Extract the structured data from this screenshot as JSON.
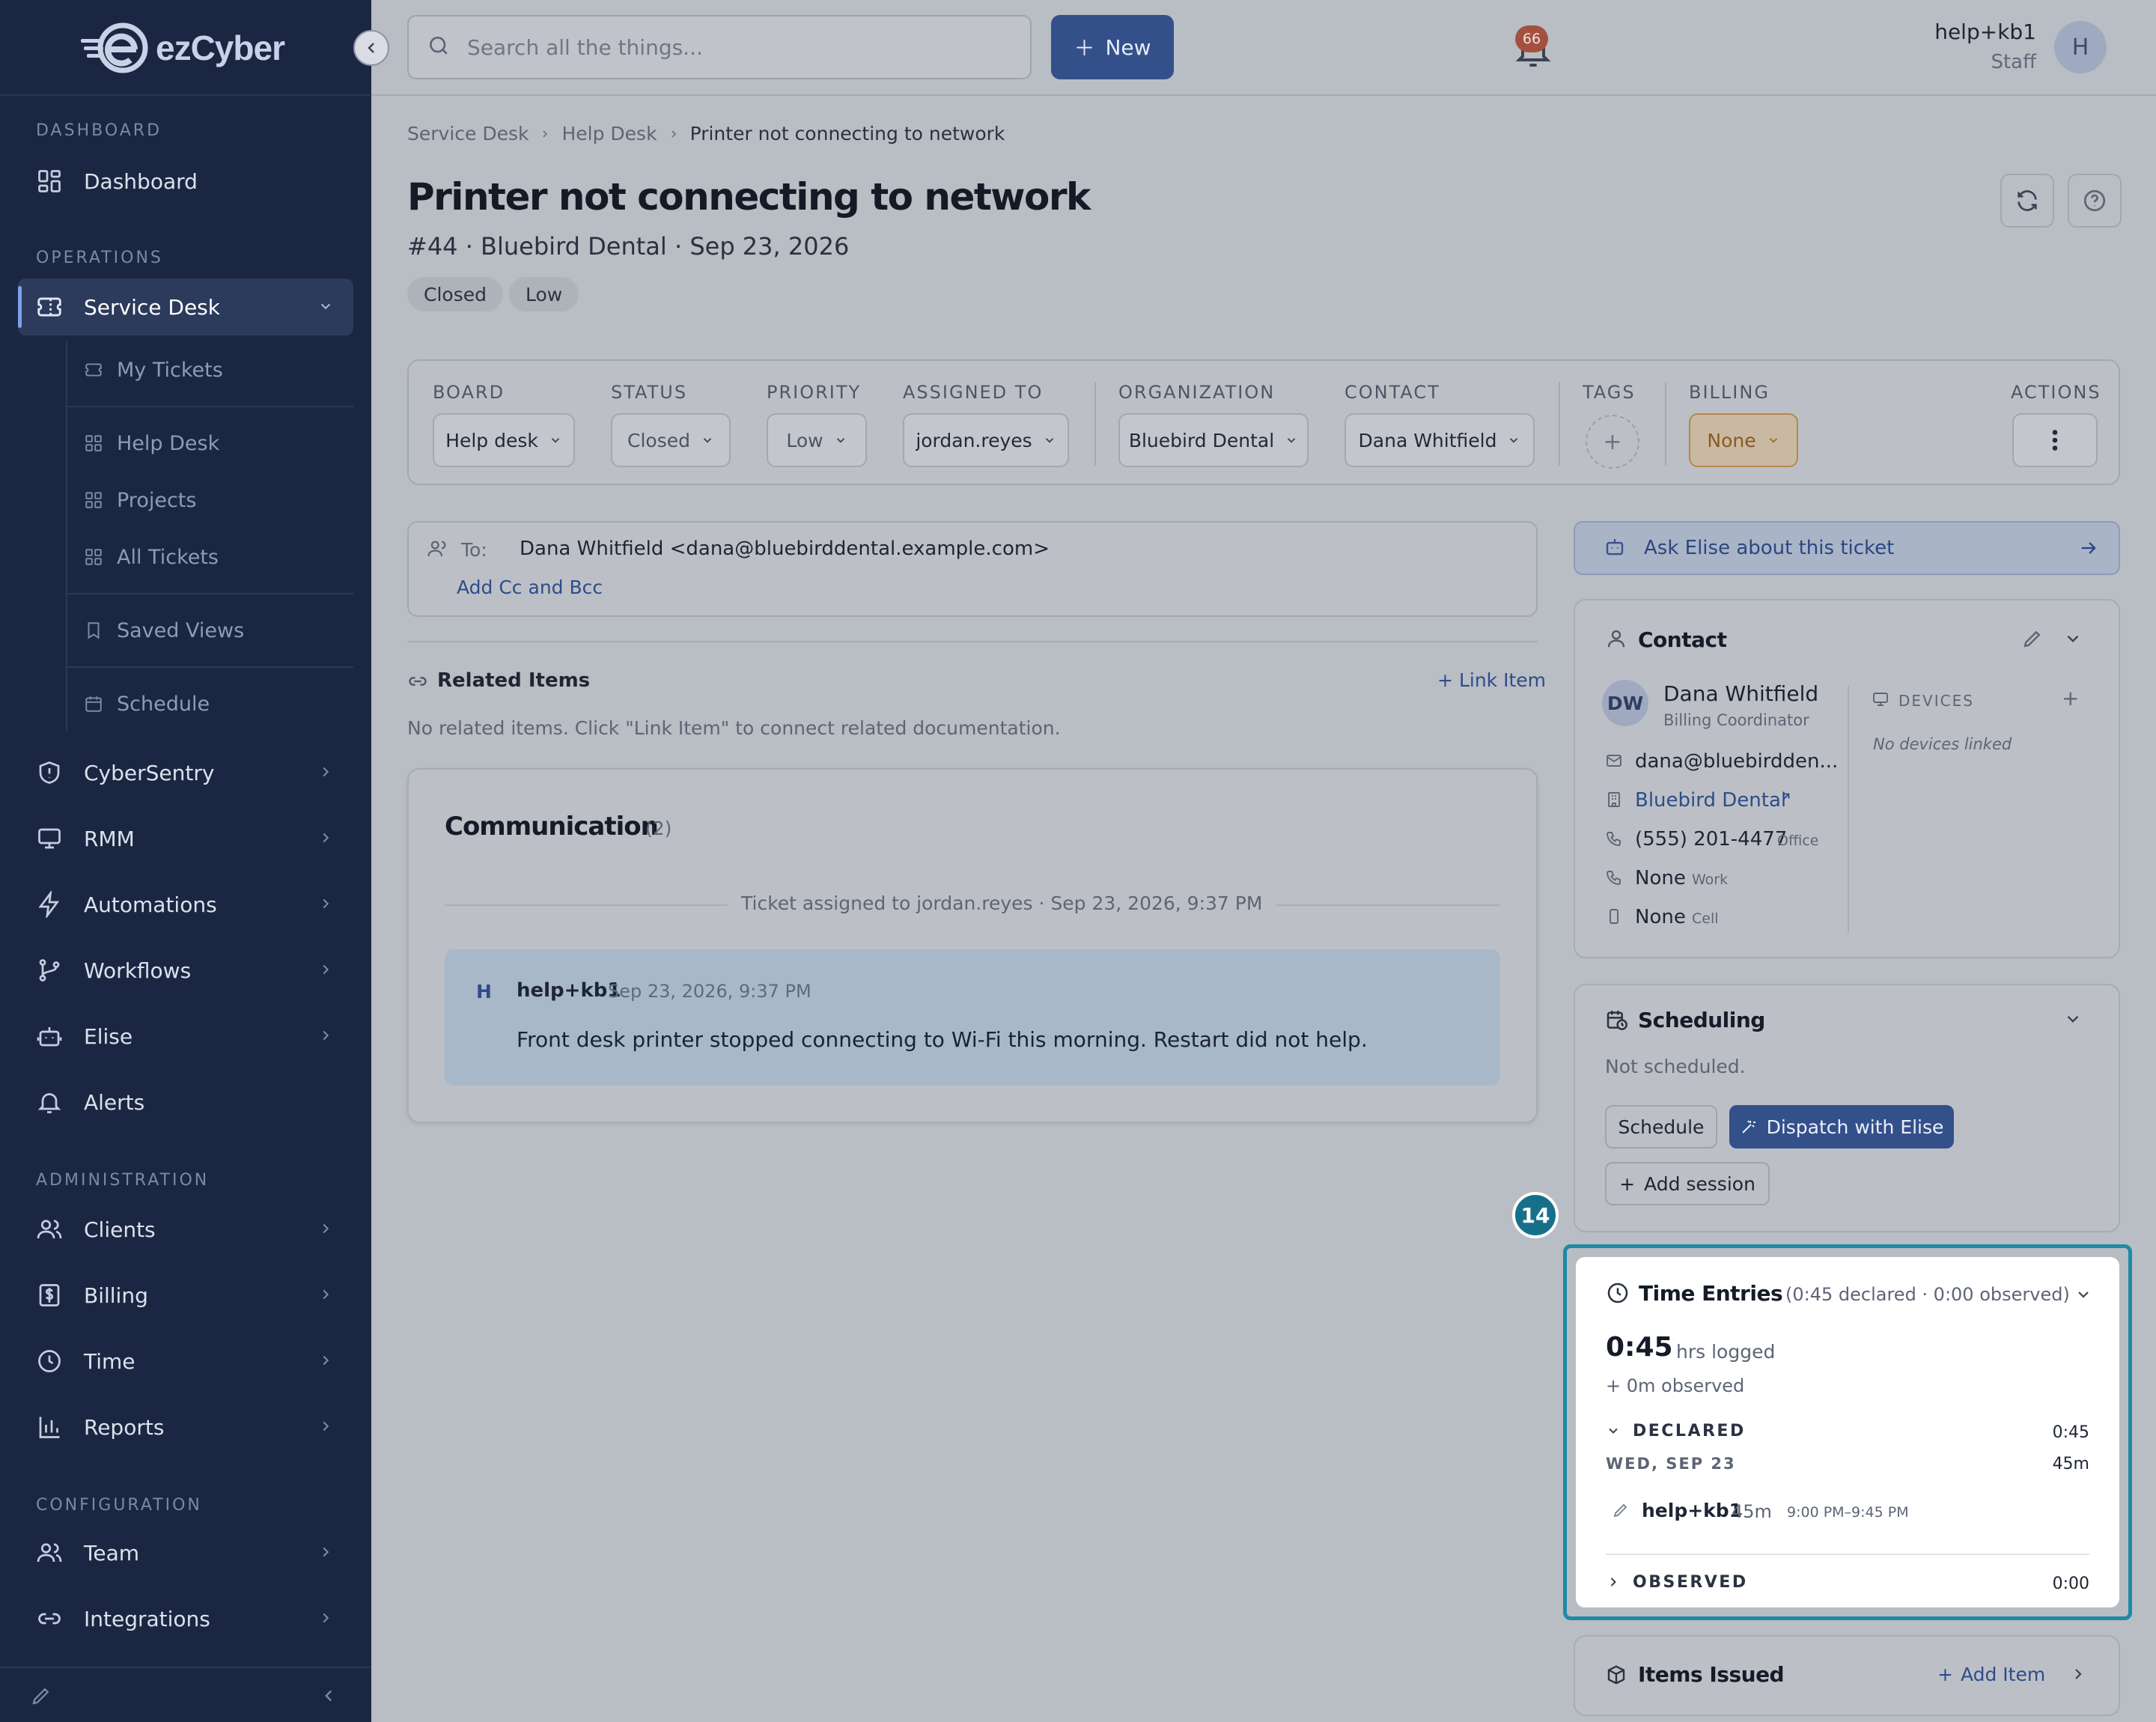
{
  "app": {
    "logo_text": "ezCyber"
  },
  "sidebar": {
    "sections": [
      "DASHBOARD",
      "OPERATIONS",
      "ADMINISTRATION",
      "CONFIGURATION"
    ],
    "dashboard": "Dashboard",
    "service_desk": "Service Desk",
    "sub_items": [
      "My Tickets",
      "Help Desk",
      "Projects",
      "All Tickets",
      "Saved Views",
      "Schedule"
    ],
    "ops_items": [
      "CyberSentry",
      "RMM",
      "Automations",
      "Workflows",
      "Elise",
      "Alerts"
    ],
    "admin_items": [
      "Clients",
      "Billing",
      "Time",
      "Reports"
    ],
    "config_items": [
      "Team",
      "Integrations"
    ]
  },
  "header": {
    "search_placeholder": "Search all the things...",
    "new_label": "New",
    "notification_count": "66",
    "user_name": "help+kb1",
    "user_role": "Staff",
    "avatar_initial": "H"
  },
  "breadcrumb": [
    "Service Desk",
    "Help Desk",
    "Printer not connecting to network"
  ],
  "ticket": {
    "title": "Printer not connecting to network",
    "subtitle": "#44 · Bluebird Dental · Sep 23, 2026",
    "pills": [
      "Closed",
      "Low"
    ]
  },
  "fields": {
    "board": {
      "label": "BOARD",
      "value": "Help desk"
    },
    "status": {
      "label": "STATUS",
      "value": "Closed"
    },
    "priority": {
      "label": "PRIORITY",
      "value": "Low"
    },
    "assigned": {
      "label": "ASSIGNED TO",
      "value": "jordan.reyes"
    },
    "organization": {
      "label": "ORGANIZATION",
      "value": "Bluebird Dental"
    },
    "contact": {
      "label": "CONTACT",
      "value": "Dana Whitfield"
    },
    "tags": {
      "label": "TAGS"
    },
    "billing": {
      "label": "BILLING",
      "value": "None"
    },
    "actions": {
      "label": "ACTIONS"
    }
  },
  "recipients": {
    "to_label": "To:",
    "to_value": "Dana Whitfield <dana@bluebirddental.example.com>",
    "add_cc": "Add Cc and Bcc"
  },
  "related": {
    "title": "Related Items",
    "link_label": "Link Item",
    "empty": "No related items. Click \"Link Item\" to connect related documentation."
  },
  "communication": {
    "title": "Communication",
    "count": "(2)",
    "event": "Ticket assigned to jordan.reyes · Sep 23, 2026, 9:37 PM",
    "message": {
      "avatar": "H",
      "author": "help+kb1",
      "time": "Sep 23, 2026, 9:37 PM",
      "body": "Front desk printer stopped connecting to Wi-Fi this morning. Restart did not help."
    }
  },
  "elise": {
    "ask_label": "Ask Elise about this ticket"
  },
  "contact_card": {
    "title": "Contact",
    "initials": "DW",
    "name": "Dana Whitfield",
    "role": "Billing Coordinator",
    "email": "dana@bluebirdden...",
    "org": "Bluebird Dental",
    "phone_office": "(555) 201-4477",
    "phone_office_label": "Office",
    "phone_work": "None",
    "phone_work_label": "Work",
    "phone_cell": "None",
    "phone_cell_label": "Cell",
    "devices_label": "DEVICES",
    "devices_empty": "No devices linked"
  },
  "scheduling": {
    "title": "Scheduling",
    "status": "Not scheduled.",
    "schedule_btn": "Schedule",
    "dispatch_btn": "Dispatch with Elise",
    "add_session": "Add session"
  },
  "time_entries": {
    "badge": "14",
    "title": "Time Entries",
    "summary": "(0:45 declared · 0:00 observed)",
    "total": "0:45",
    "total_unit": "hrs logged",
    "observed_line": "+ 0m observed",
    "declared_label": "DECLARED",
    "declared_total": "0:45",
    "day_label": "WED, SEP 23",
    "day_total": "45m",
    "entry_user": "help+kb1",
    "entry_duration": "45m",
    "entry_range": "9:00 PM–9:45 PM",
    "observed_label": "OBSERVED",
    "observed_total": "0:00"
  },
  "items_issued": {
    "title": "Items Issued",
    "add_label": "Add Item"
  },
  "colors": {
    "sidebar": "#1b2742",
    "accent": "#34508a",
    "highlight": "#1e8aa6"
  }
}
